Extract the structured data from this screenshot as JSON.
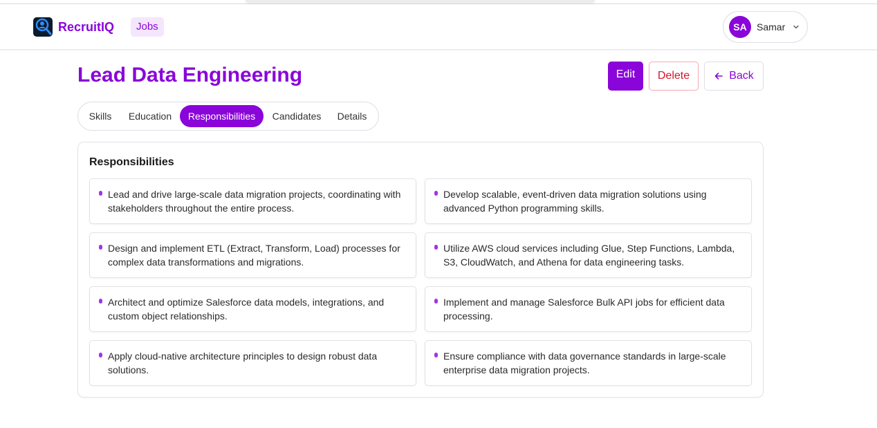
{
  "app": {
    "name": "RecruitIQ"
  },
  "nav": {
    "jobs_label": "Jobs"
  },
  "user": {
    "initials": "SA",
    "name": "Samar"
  },
  "job": {
    "title": "Lead Data Engineering"
  },
  "actions": {
    "edit_label": "Edit",
    "delete_label": "Delete",
    "back_label": "Back"
  },
  "tabs": [
    {
      "label": "Skills",
      "active": false
    },
    {
      "label": "Education",
      "active": false
    },
    {
      "label": "Responsibilities",
      "active": true
    },
    {
      "label": "Candidates",
      "active": false
    },
    {
      "label": "Details",
      "active": false
    }
  ],
  "responsibilities": {
    "heading": "Responsibilities",
    "items": [
      "Lead and drive large-scale data migration projects, coordinating with stakeholders throughout the entire process.",
      "Develop scalable, event-driven data migration solutions using advanced Python programming skills.",
      "Design and implement ETL (Extract, Transform, Load) processes for complex data transformations and migrations.",
      "Utilize AWS cloud services including Glue, Step Functions, Lambda, S3, CloudWatch, and Athena for data engineering tasks.",
      "Architect and optimize Salesforce data models, integrations, and custom object relationships.",
      "Implement and manage Salesforce Bulk API jobs for efficient data processing.",
      "Apply cloud-native architecture principles to design robust data solutions.",
      "Ensure compliance with data governance standards in large-scale enterprise data migration projects."
    ]
  },
  "colors": {
    "brand": "#8a05d9",
    "danger": "#d8132b",
    "active_tab_bg": "#8a05d9",
    "nav_chip_bg": "#f4e6fd"
  },
  "icons": {
    "logo": "magnifier-person-icon",
    "user_menu": "chevron-down-icon",
    "back": "arrow-left-icon",
    "bullet": "bullet-dot-icon"
  }
}
